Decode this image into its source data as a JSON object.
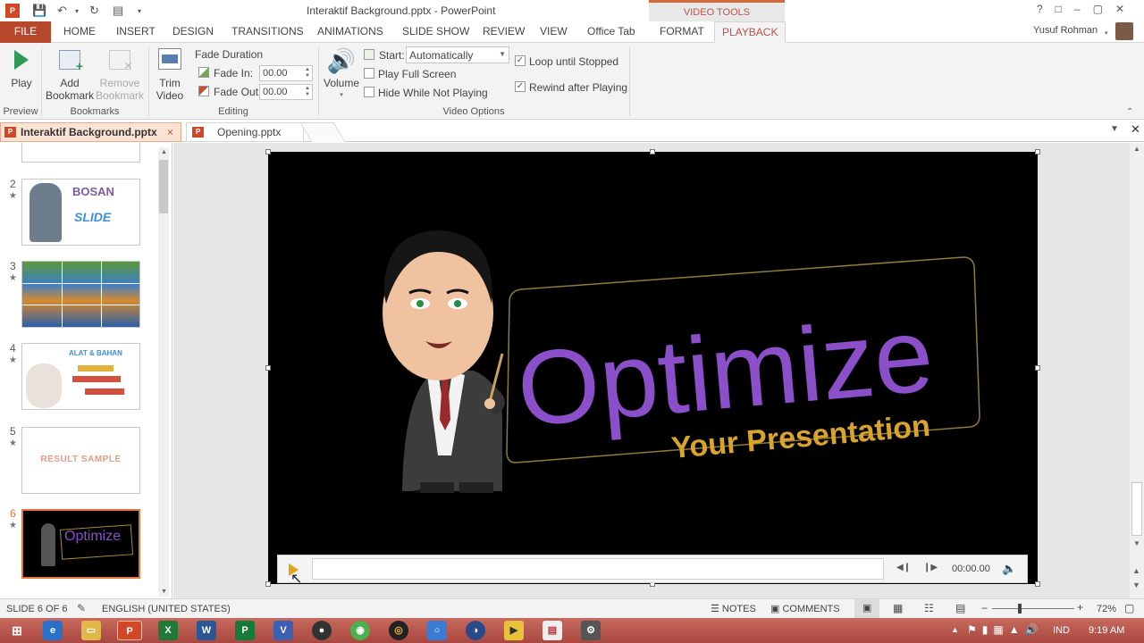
{
  "window": {
    "title": "Interaktif Background.pptx - PowerPoint",
    "context_group": "VIDEO TOOLS",
    "user": "Yusuf Rohman",
    "controls": [
      "?",
      "□",
      "–",
      "▢",
      "✕"
    ]
  },
  "tabs": [
    {
      "label": "FILE"
    },
    {
      "label": "HOME"
    },
    {
      "label": "INSERT"
    },
    {
      "label": "DESIGN"
    },
    {
      "label": "TRANSITIONS"
    },
    {
      "label": "ANIMATIONS"
    },
    {
      "label": "SLIDE SHOW"
    },
    {
      "label": "REVIEW"
    },
    {
      "label": "VIEW"
    },
    {
      "label": "Office Tab"
    },
    {
      "label": "FORMAT"
    },
    {
      "label": "PLAYBACK"
    }
  ],
  "ribbon": {
    "preview": {
      "group": "Preview",
      "play": "Play"
    },
    "bookmarks": {
      "group": "Bookmarks",
      "add_1": "Add",
      "add_2": "Bookmark",
      "remove_1": "Remove",
      "remove_2": "Bookmark"
    },
    "editing": {
      "group": "Editing",
      "trim_1": "Trim",
      "trim_2": "Video",
      "fade_duration": "Fade Duration",
      "fade_in_label": "Fade In:",
      "fade_in_value": "00.00",
      "fade_out_label": "Fade Out:",
      "fade_out_value": "00.00"
    },
    "video_options": {
      "group": "Video Options",
      "volume": "Volume",
      "start_label": "Start:",
      "start_value": "Automatically",
      "play_full_screen": "Play Full Screen",
      "play_full_screen_checked": false,
      "hide_while_not_playing": "Hide While Not Playing",
      "hide_while_not_playing_checked": false,
      "loop_until_stopped": "Loop until Stopped",
      "loop_until_stopped_checked": true,
      "rewind_after_playing": "Rewind after Playing",
      "rewind_after_playing_checked": true
    }
  },
  "doc_tabs": [
    {
      "label": "Interaktif Background.pptx",
      "close": "×"
    },
    {
      "label": "Opening.pptx"
    }
  ],
  "slides": [
    {
      "number": "2",
      "text_1": "BOSAN",
      "text_2": "SLIDE"
    },
    {
      "number": "3"
    },
    {
      "number": "4",
      "text_1": "ALAT & BAHAN"
    },
    {
      "number": "5",
      "text_1": "RESULT SAMPLE"
    },
    {
      "number": "6",
      "text_1": "Optimize"
    }
  ],
  "current_slide": {
    "title": "Optimize",
    "subtitle": "Your Presentation"
  },
  "player": {
    "time": "00:00.00"
  },
  "status": {
    "slide": "SLIDE 6 OF 6",
    "language": "ENGLISH (UNITED STATES)",
    "notes": "NOTES",
    "comments": "COMMENTS",
    "zoom": "72%"
  },
  "taskbar": {
    "language": "IND",
    "clock": "9:19 AM"
  },
  "colors": {
    "file_tab": "#b7472a",
    "accent": "#c0504d",
    "optimize_purple": "#8a4fc9",
    "subtitle_gold": "#d9a428",
    "taskbar": "#b65249"
  }
}
